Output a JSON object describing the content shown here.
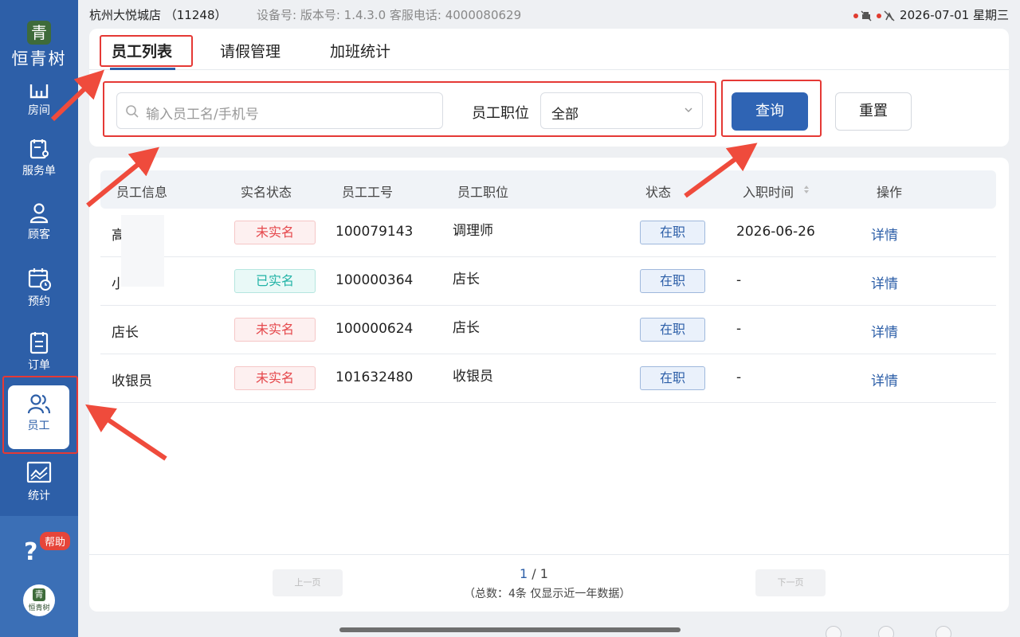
{
  "statusbar": {
    "store": "杭州大悦城店 （11248）",
    "device_info": "设备号:  版本号:  1.4.3.0  客服电话:  4000080629",
    "datetime": "2026-07-01 星期三"
  },
  "brand": {
    "mark": "青",
    "name": "恒青树"
  },
  "sidebar": {
    "items": [
      {
        "label": "房间",
        "icon": "room-icon"
      },
      {
        "label": "服务单",
        "icon": "service-order-icon"
      },
      {
        "label": "顾客",
        "icon": "customer-icon"
      },
      {
        "label": "预约",
        "icon": "calendar-clock-icon"
      },
      {
        "label": "订单",
        "icon": "order-icon"
      },
      {
        "label": "员工",
        "icon": "staff-icon"
      },
      {
        "label": "统计",
        "icon": "stats-icon"
      }
    ],
    "help_badge": "帮助",
    "avatar_text": "恒青树"
  },
  "tabs": [
    "员工列表",
    "请假管理",
    "加班统计"
  ],
  "filters": {
    "search_placeholder": "输入员工名/手机号",
    "position_label": "员工职位",
    "position_value": "全部",
    "query_button": "查询",
    "reset_button": "重置"
  },
  "table": {
    "headers": [
      "员工信息",
      "实名状态",
      "员工工号",
      "员工职位",
      "状态",
      "入职时间",
      "操作"
    ],
    "rows": [
      {
        "name": "高",
        "verify": "未实名",
        "verify_color": "red",
        "id": "100079143",
        "position": "调理师",
        "status": "在职",
        "hired": "2026-06-26",
        "action": "详情"
      },
      {
        "name": "小",
        "verify": "已实名",
        "verify_color": "green",
        "id": "100000364",
        "position": "店长",
        "status": "在职",
        "hired": "-",
        "action": "详情"
      },
      {
        "name": "店长",
        "verify": "未实名",
        "verify_color": "red",
        "id": "100000624",
        "position": "店长",
        "status": "在职",
        "hired": "-",
        "action": "详情"
      },
      {
        "name": "收银员",
        "verify": "未实名",
        "verify_color": "red",
        "id": "101632480",
        "position": "收银员",
        "status": "在职",
        "hired": "-",
        "action": "详情"
      }
    ]
  },
  "pager": {
    "prev": "上一页",
    "next": "下一页",
    "current": "1",
    "total_pages": "/ 1",
    "summary": "（总数：4条 仅显示近一年数据）"
  },
  "colors": {
    "primary": "#2d5fa8",
    "annotation": "#e53935"
  }
}
